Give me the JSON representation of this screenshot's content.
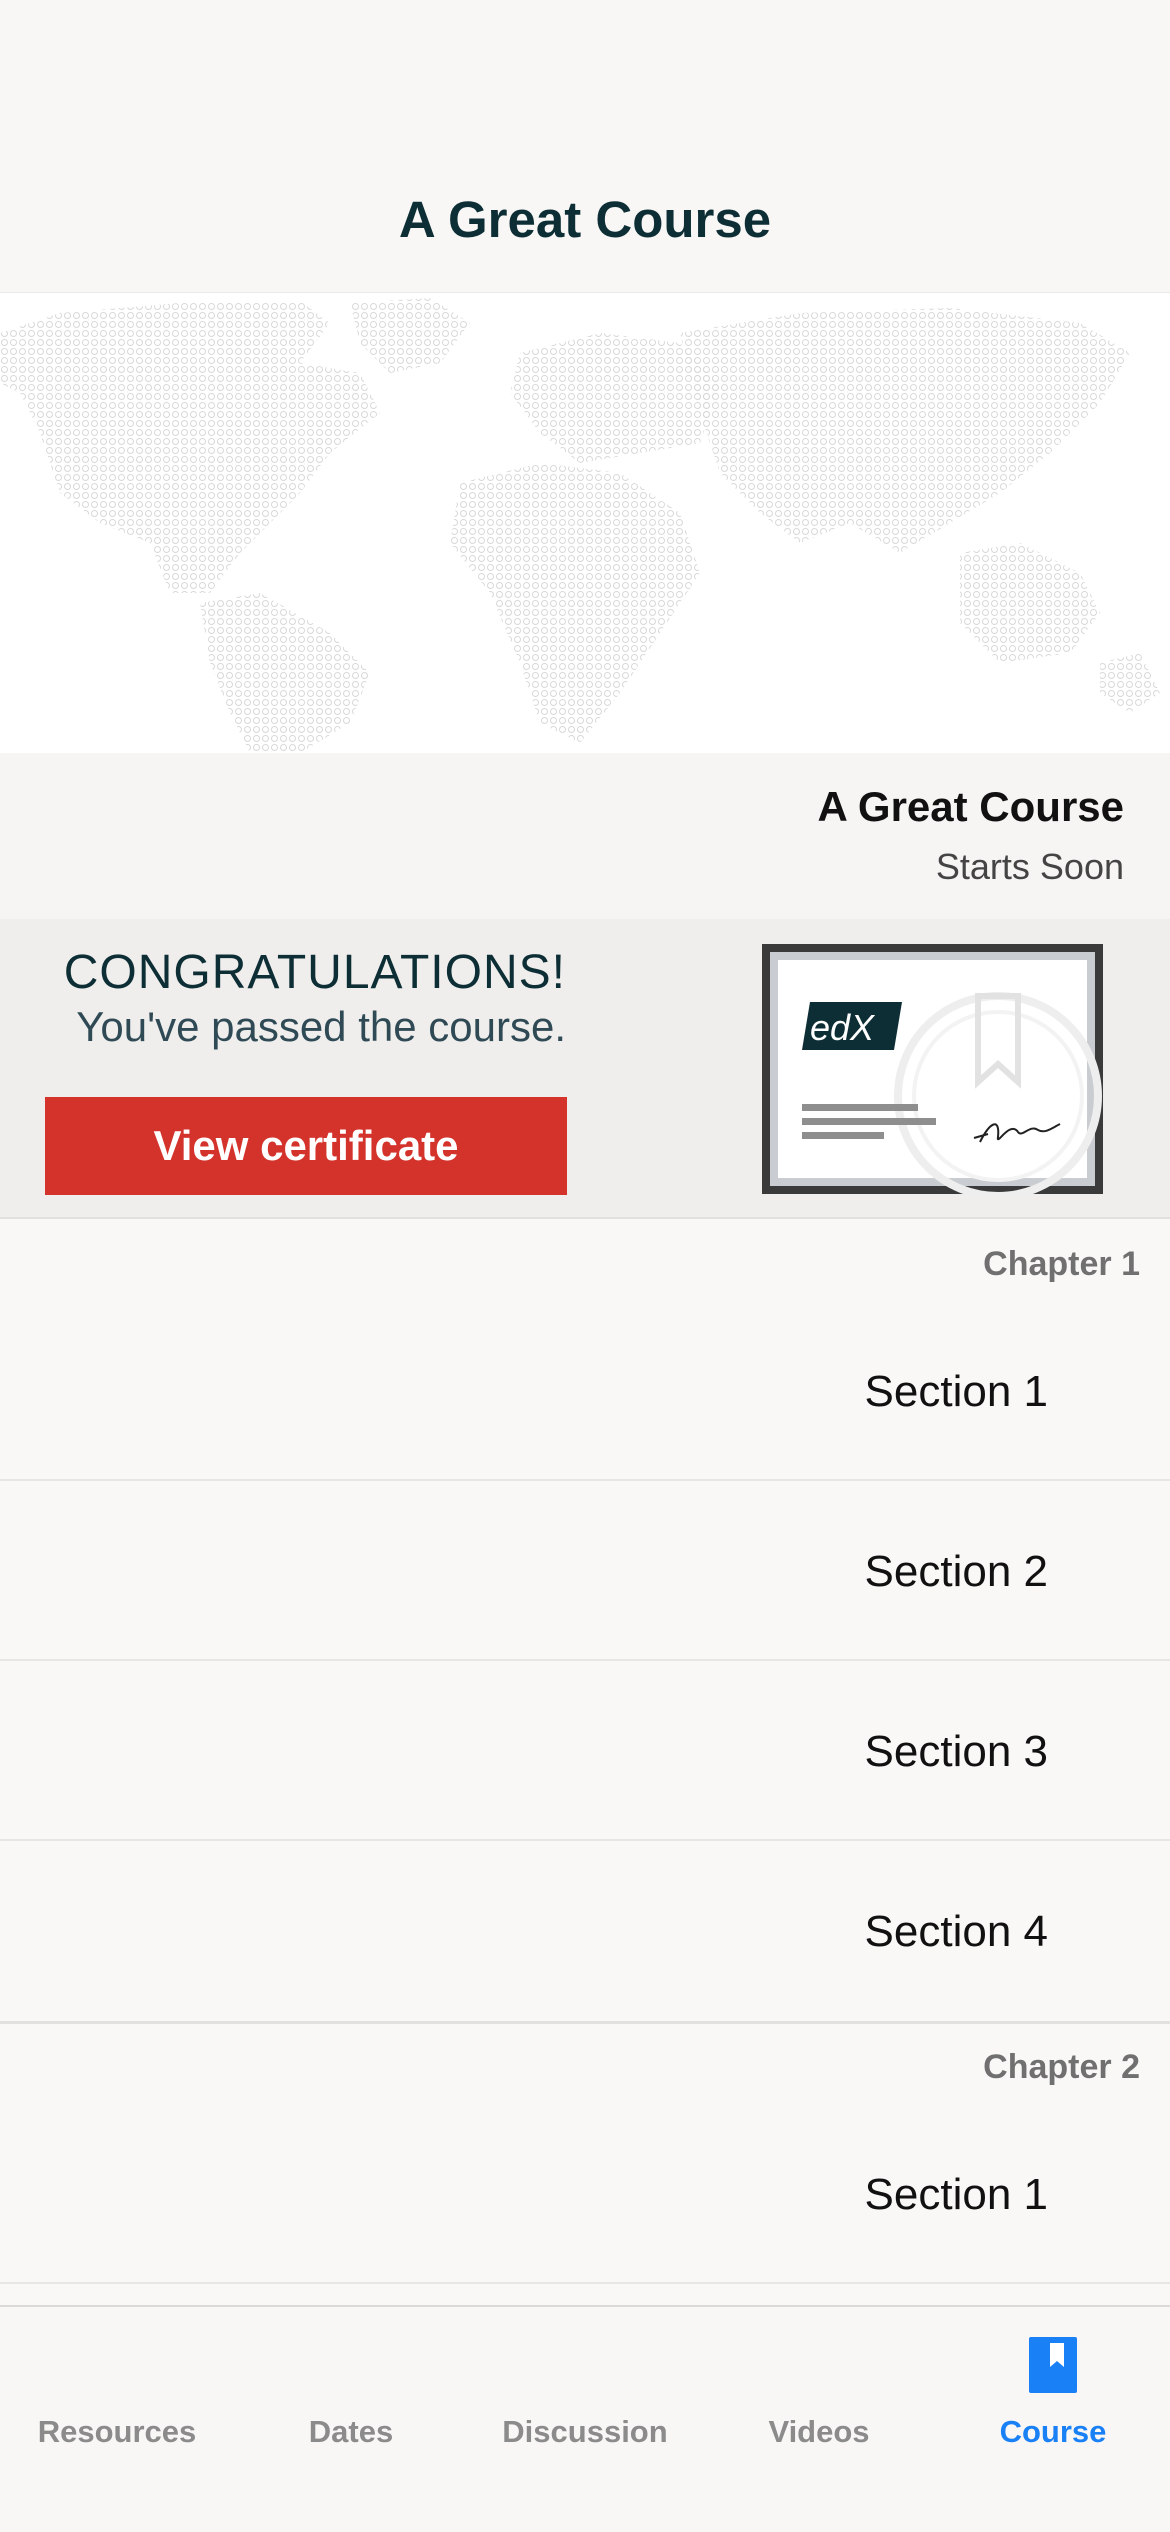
{
  "header": {
    "title": "A Great Course"
  },
  "course": {
    "name": "A Great Course",
    "status": "Starts Soon"
  },
  "certificate": {
    "congrats": "CONGRATULATIONS!",
    "message": "You've passed the course.",
    "button_label": "View certificate",
    "logo_text": "edX"
  },
  "outline": {
    "chapters": [
      {
        "title": "Chapter 1",
        "sections": [
          "Section 1",
          "Section 2",
          "Section 3",
          "Section 4"
        ]
      },
      {
        "title": "Chapter 2",
        "sections": [
          "Section 1"
        ]
      }
    ]
  },
  "tabs": [
    {
      "label": "Resources",
      "active": false
    },
    {
      "label": "Dates",
      "active": false
    },
    {
      "label": "Discussion",
      "active": false
    },
    {
      "label": "Videos",
      "active": false
    },
    {
      "label": "Course",
      "active": true,
      "icon": "bookmark-icon"
    }
  ],
  "colors": {
    "accent": "#1a80f5",
    "button": "#d4332c",
    "title": "#0d2e35",
    "inactive_tab": "#8b8b8b"
  }
}
